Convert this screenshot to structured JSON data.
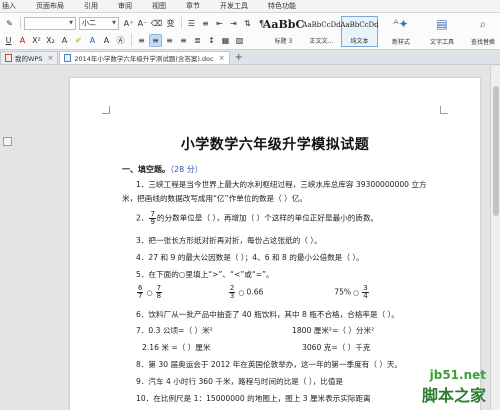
{
  "menu": {
    "items": [
      "插入",
      "页面布局",
      "引用",
      "审阅",
      "视图",
      "章节",
      "开发工具",
      "特色功能"
    ]
  },
  "ribbon": {
    "font_size": "小二",
    "row2_left": "U · A",
    "styles": [
      {
        "sample": "AaBbC",
        "name": "标题 3"
      },
      {
        "sample": "AaBbCcDd",
        "name": "正文文..."
      },
      {
        "sample": "AaBbCcDd",
        "name": "纯文本"
      }
    ],
    "new_style": "新样式",
    "text_tools": "文字工具",
    "replace": "查找替换"
  },
  "doctabs": {
    "tab1": "我的WPS",
    "tab2": "2014年小学数学六年级升学测试题(含答案).doc",
    "plus": "+"
  },
  "doc": {
    "title": "小学数学六年级升学模拟试题",
    "section": {
      "heading": "一、填空题。",
      "score": "（28 分）"
    },
    "q1a": "1．三峡工程是当今世界上最大的水利枢纽过程，三峡水库总库容 39300000000 立方",
    "q1b": "米，把画线的数据改写成用“亿”作单位的数是（          ）亿。",
    "q2_pre": "2．",
    "q2_num": "7",
    "q2_den": "9",
    "q2_post": "的分数单位是（    ），再增加（    ）个这样的单位正好是最小的质数。",
    "q3": "3．把一张长方形纸对折再对折，每份占这张纸的（     ）。",
    "q4": "4．27 和 9 的最大公因数是（    ）；4、6 和 8 的最小公倍数是（    ）。",
    "q5": "5．在下面的○里填上“>”、“<”或“=”。",
    "q5_f1n": "6",
    "q5_f1d": "7",
    "q5_f2n": "7",
    "q5_f2d": "8",
    "q5_f3n": "2",
    "q5_f3d": "3",
    "q5_mid": "0.66",
    "q5_pct": "75%",
    "q5_f4n": "3",
    "q5_f4d": "4",
    "q6": "6．饮料厂从一批产品中抽查了 40 瓶饮料，其中 8 瓶不合格，合格率是（     ）。",
    "q7a": "7．0.3 公顷=（      ）米²",
    "q7b": "1800 厘米²=（      ）分米²",
    "q7c": "2.16 米 =（      ）厘米",
    "q7d": "3060 克=（      ）千克",
    "q8": "8．第 30 届奥运会于 2012 年在英国伦敦举办，这一年的第一季度有（     ）天。",
    "q9": "9．汽车 4 小时行 360 千米，路程与时间的比是（          ），比值是",
    "q10": "10．在比例尺是 1：15000000 的地图上，图上 3 厘米表示实际距离"
  },
  "watermark": {
    "site": "jb51.net",
    "brand": "脚本之家"
  }
}
